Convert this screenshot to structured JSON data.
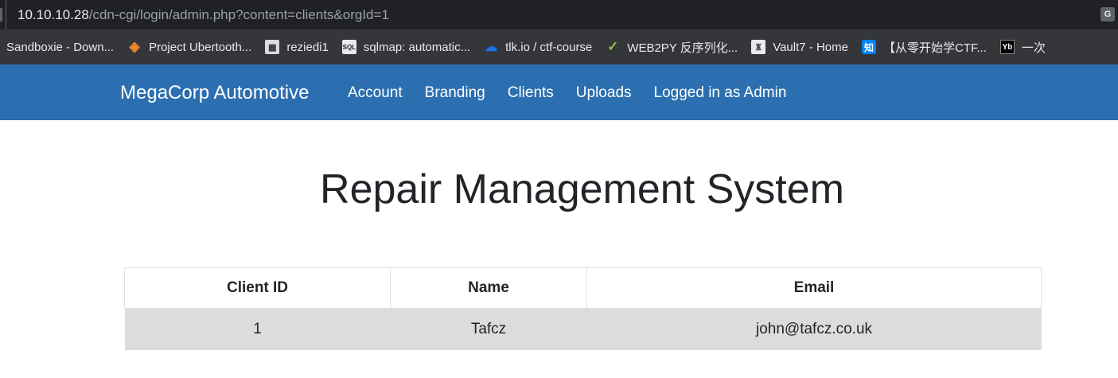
{
  "browser": {
    "url_host": "10.10.10.28",
    "url_path": "/cdn-cgi/login/admin.php?content=clients&orgId=1",
    "translate_icon": "translate-icon",
    "bookmarks": [
      {
        "label": "Sandboxie - Down...",
        "icon": "none"
      },
      {
        "label": "Project Ubertooth...",
        "icon": "diamond-icon"
      },
      {
        "label": "reziedi1",
        "icon": "page-icon"
      },
      {
        "label": "sqlmap: automatic...",
        "icon": "sql-icon"
      },
      {
        "label": "tlk.io / ctf-course",
        "icon": "cloud-icon"
      },
      {
        "label": "WEB2PY 反序列化...",
        "icon": "checkmark-icon"
      },
      {
        "label": "Vault7 - Home",
        "icon": "vault-icon"
      },
      {
        "label": "【从零开始学CTF...",
        "icon": "zhihu-icon"
      },
      {
        "label": "一次",
        "icon": "yd-icon"
      }
    ]
  },
  "navbar": {
    "brand": "MegaCorp Automotive",
    "links": [
      "Account",
      "Branding",
      "Clients",
      "Uploads",
      "Logged in as Admin"
    ]
  },
  "main": {
    "title": "Repair Management System",
    "table": {
      "headers": [
        "Client ID",
        "Name",
        "Email"
      ],
      "rows": [
        [
          "1",
          "Tafcz",
          "john@tafcz.co.uk"
        ]
      ]
    }
  },
  "colors": {
    "navbar": "#2c6fb0",
    "row_bg": "#dcdcdc",
    "address_bar": "#202124",
    "bookmarks_bar": "#35363a"
  }
}
